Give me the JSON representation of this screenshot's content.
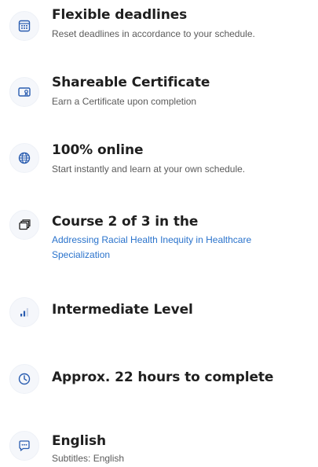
{
  "features": [
    {
      "icon": "calendar-icon",
      "title": "Flexible deadlines",
      "subtitle": "Reset deadlines in accordance to your schedule."
    },
    {
      "icon": "certificate-icon",
      "title": "Shareable Certificate",
      "subtitle": "Earn a Certificate upon completion"
    },
    {
      "icon": "globe-icon",
      "title": "100% online",
      "subtitle": "Start instantly and learn at your own schedule."
    },
    {
      "icon": "stacked-cards-icon",
      "title": "Course 2 of 3 in the",
      "link": "Addressing Racial Health Inequity in Healthcare Specialization"
    },
    {
      "icon": "level-bars-icon",
      "title": "Intermediate Level"
    },
    {
      "icon": "clock-icon",
      "title": "Approx. 22 hours to complete"
    },
    {
      "icon": "speech-bubble-icon",
      "title": "English",
      "subtitle": "Subtitles: English"
    }
  ],
  "colors": {
    "icon_stroke": "#2a5db0",
    "link": "#2a73cc",
    "title": "#1f1f1f",
    "subtitle": "#5b5b5b"
  }
}
